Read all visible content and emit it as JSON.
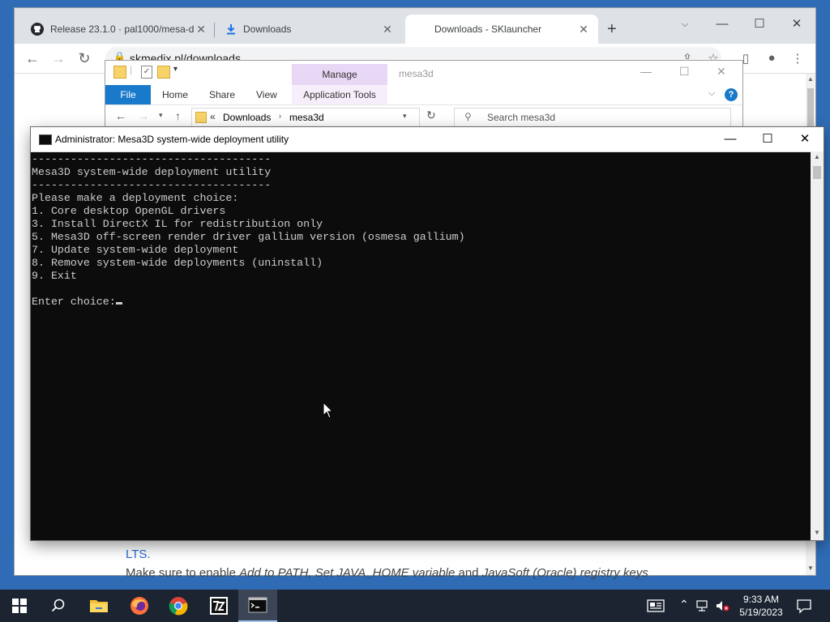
{
  "browser": {
    "tabs": [
      {
        "title": "Release 23.1.0 · pal1000/mesa-d",
        "icon": "github-icon"
      },
      {
        "title": "Downloads",
        "icon": "download-icon"
      },
      {
        "title": "Downloads - SKlauncher",
        "icon": "none"
      }
    ],
    "url": "skmedix.pl/downloads",
    "page": {
      "lts_text": "LTS.",
      "enable_prefix": "Make sure to enable ",
      "enable_path": "Add to PATH, Set JAVA_HOME variable",
      "enable_and": " and ",
      "enable_keys": "JavaSoft (Oracle) registry keys"
    }
  },
  "explorer": {
    "manage_label": "Manage",
    "window_name": "mesa3d",
    "ribbon_tabs": [
      "File",
      "Home",
      "Share",
      "View",
      "Application Tools"
    ],
    "breadcrumb_root": "Downloads",
    "breadcrumb_current": "mesa3d",
    "search_placeholder": "Search mesa3d"
  },
  "console": {
    "title": "Administrator:  Mesa3D system-wide deployment utility",
    "lines": [
      "-------------------------------------",
      "Mesa3D system-wide deployment utility",
      "-------------------------------------",
      "Please make a deployment choice:",
      "1. Core desktop OpenGL drivers",
      "3. Install DirectX IL for redistribution only",
      "5. Mesa3D off-screen render driver gallium version (osmesa gallium)",
      "7. Update system-wide deployment",
      "8. Remove system-wide deployments (uninstall)",
      "9. Exit",
      "",
      "Enter choice:"
    ]
  },
  "taskbar": {
    "apps": [
      "start-button",
      "search-button",
      "file-explorer",
      "firefox",
      "chrome",
      "7zip",
      "command-prompt"
    ],
    "time": "9:33 AM",
    "date": "5/19/2023"
  },
  "colors": {
    "desktop": "#2f6cb5",
    "console_bg": "#0c0c0c",
    "console_text": "#cccccc",
    "manage_tab": "#e9d8f5",
    "file_tab": "#1979ca",
    "taskbar": "#1c2431"
  }
}
